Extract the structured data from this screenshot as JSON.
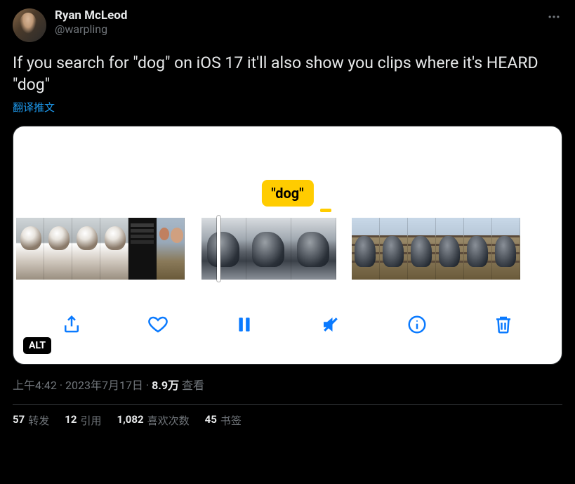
{
  "author": {
    "display_name": "Ryan McLeod",
    "handle": "@warpling"
  },
  "body_text": "If you search for \"dog\" on iOS 17 it'll also show you clips where it's HEARD \"dog\"",
  "translate_label": "翻译推文",
  "media": {
    "search_keyword_label": "\"dog\"",
    "alt_badge": "ALT"
  },
  "meta": {
    "time": "上午4:42",
    "date": "2023年7月17日",
    "views_count": "8.9万",
    "views_label": "查看",
    "separator": " · "
  },
  "stats": {
    "retweets": {
      "count": "57",
      "label": "转发"
    },
    "quotes": {
      "count": "12",
      "label": "引用"
    },
    "likes": {
      "count": "1,082",
      "label": "喜欢次数"
    },
    "bookmarks": {
      "count": "45",
      "label": "书签"
    }
  }
}
